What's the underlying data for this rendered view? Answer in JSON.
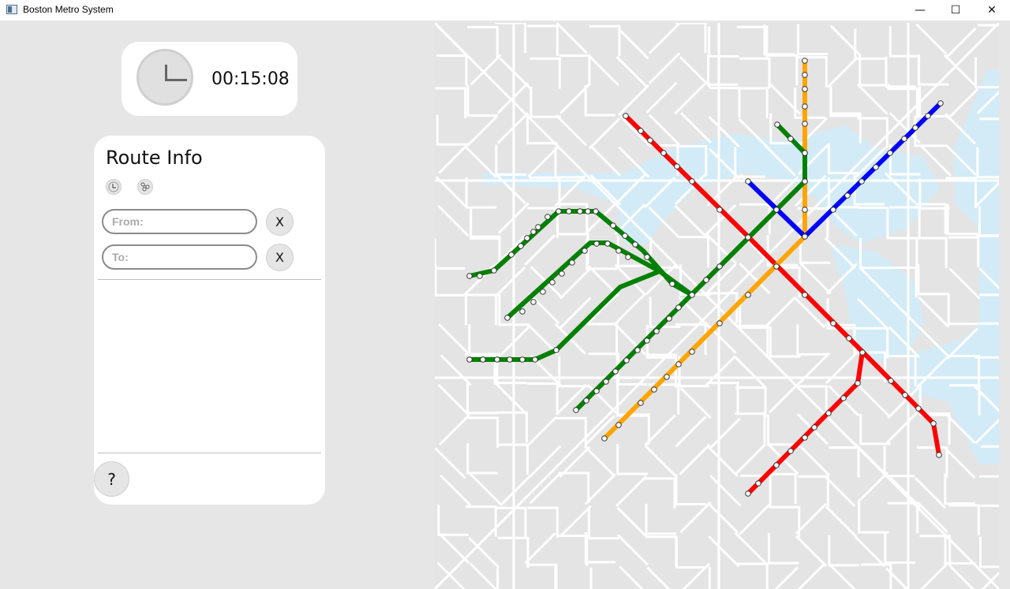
{
  "window": {
    "title": "Boston Metro System",
    "minimize": "—",
    "maximize": "☐",
    "close": "✕"
  },
  "clock": {
    "icon": "clock-icon",
    "time": "00:15:08"
  },
  "route_info": {
    "title": "Route Info",
    "mode_buttons": [
      {
        "icon": "clock-icon"
      },
      {
        "icon": "network-icon"
      }
    ],
    "from": {
      "placeholder": "From:",
      "value": "",
      "clear_label": "X"
    },
    "to": {
      "placeholder": "To:",
      "value": "",
      "clear_label": "X"
    },
    "help_label": "?"
  },
  "map": {
    "water_color": "#d2ebf7",
    "street_color": "#ffffff",
    "lines": [
      {
        "color": "#ff0000",
        "stations": 27
      },
      {
        "color": "#ffa500",
        "stations": 19
      },
      {
        "color": "#008000",
        "stations": 58
      },
      {
        "color": "#0000ff",
        "stations": 12
      }
    ]
  }
}
